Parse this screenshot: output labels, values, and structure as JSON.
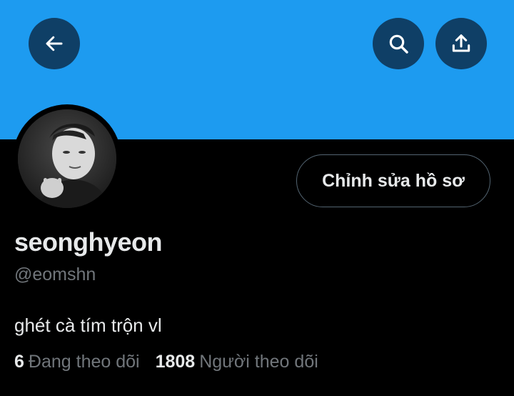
{
  "header": {
    "banner_color": "#1d9bf0",
    "buttons": [
      {
        "icon": "arrow-left-icon"
      },
      {
        "icon": "search-icon"
      },
      {
        "icon": "share-upload-icon"
      }
    ]
  },
  "profile": {
    "edit_button_label": "Chỉnh sửa hồ sơ",
    "display_name": "seonghyeon",
    "handle": "@eomshn",
    "bio": "ghét cà tím trộn vl",
    "stats": {
      "following_count": "6",
      "following_label": "Đang theo dõi",
      "followers_count": "1808",
      "followers_label": "Người theo dõi"
    }
  }
}
